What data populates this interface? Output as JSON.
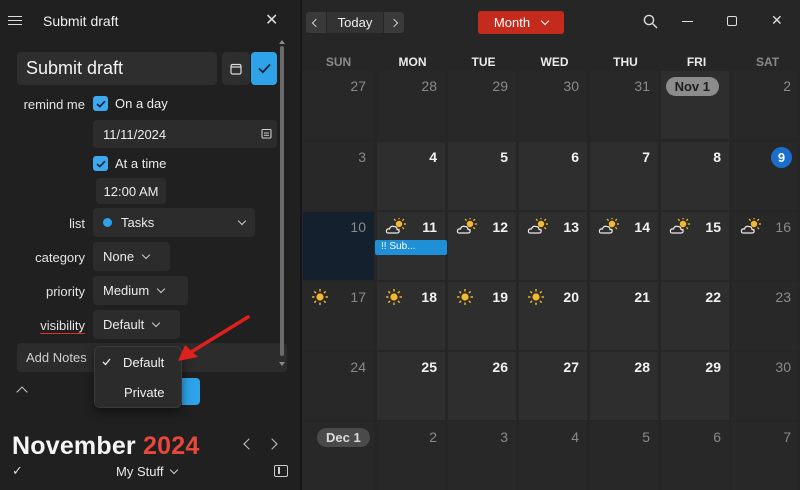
{
  "panel": {
    "title": "Submit draft",
    "task_title": "Submit draft",
    "remind_me_label": "remind me",
    "on_a_day_label": "On a day",
    "date_value": "11/11/2024",
    "at_a_time_label": "At a time",
    "time_value": "12:00 AM",
    "list_label": "list",
    "list_value": "Tasks",
    "category_label": "category",
    "category_value": "None",
    "priority_label": "priority",
    "priority_value": "Medium",
    "visibility_label": "visibility",
    "visibility_value": "Default",
    "notes_placeholder": "Add Notes",
    "visibility_options": [
      "Default",
      "Private"
    ],
    "selected_option": "Default"
  },
  "mini": {
    "month": "November",
    "year": "2024",
    "calendar_name": "My Stuff"
  },
  "calendar": {
    "today_label": "Today",
    "view_label": "Month",
    "weekdays": [
      "SUN",
      "MON",
      "TUE",
      "WED",
      "THU",
      "FRI",
      "SAT"
    ],
    "weeks": [
      [
        "27",
        "28",
        "29",
        "30",
        "31",
        "Nov 1",
        "2"
      ],
      [
        "3",
        "4",
        "5",
        "6",
        "7",
        "8",
        "9"
      ],
      [
        "10",
        "11",
        "12",
        "13",
        "14",
        "15",
        "16"
      ],
      [
        "17",
        "18",
        "19",
        "20",
        "21",
        "22",
        "23"
      ],
      [
        "24",
        "25",
        "26",
        "27",
        "28",
        "29",
        "30"
      ],
      [
        "Dec 1",
        "2",
        "3",
        "4",
        "5",
        "6",
        "7"
      ]
    ],
    "event_label": "!! Sub...",
    "today_day": "9"
  },
  "colors": {
    "accent": "#2ea3ea",
    "brand_red": "#c42b1c",
    "year_red": "#e8473b",
    "today_blue": "#1a6fcc",
    "sun_yellow": "#f5b82e"
  }
}
